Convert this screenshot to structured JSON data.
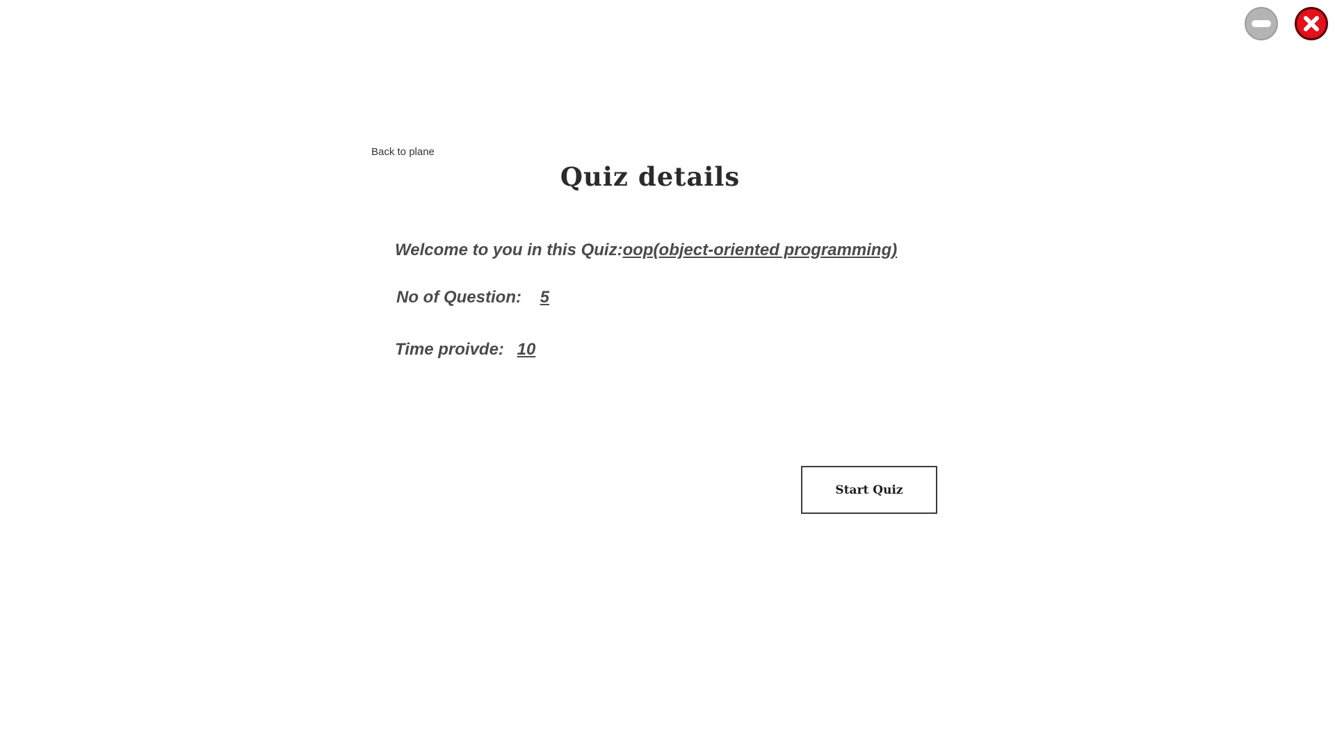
{
  "window_controls": {
    "minimize_icon": "minimize-icon",
    "close_icon": "close-icon",
    "minimize_color": "#b4b4b4",
    "close_color": "#e2111a"
  },
  "nav": {
    "back_label": "Back to plane"
  },
  "header": {
    "title": "Quiz details"
  },
  "quiz": {
    "welcome_label": "Welcome to you in this Quiz:",
    "name": "oop(object-oriented programming)",
    "questions_label": "No of Question:",
    "questions_value": "5",
    "time_label": "Time proivde:",
    "time_value": "10"
  },
  "actions": {
    "start_label": "Start Quiz"
  }
}
